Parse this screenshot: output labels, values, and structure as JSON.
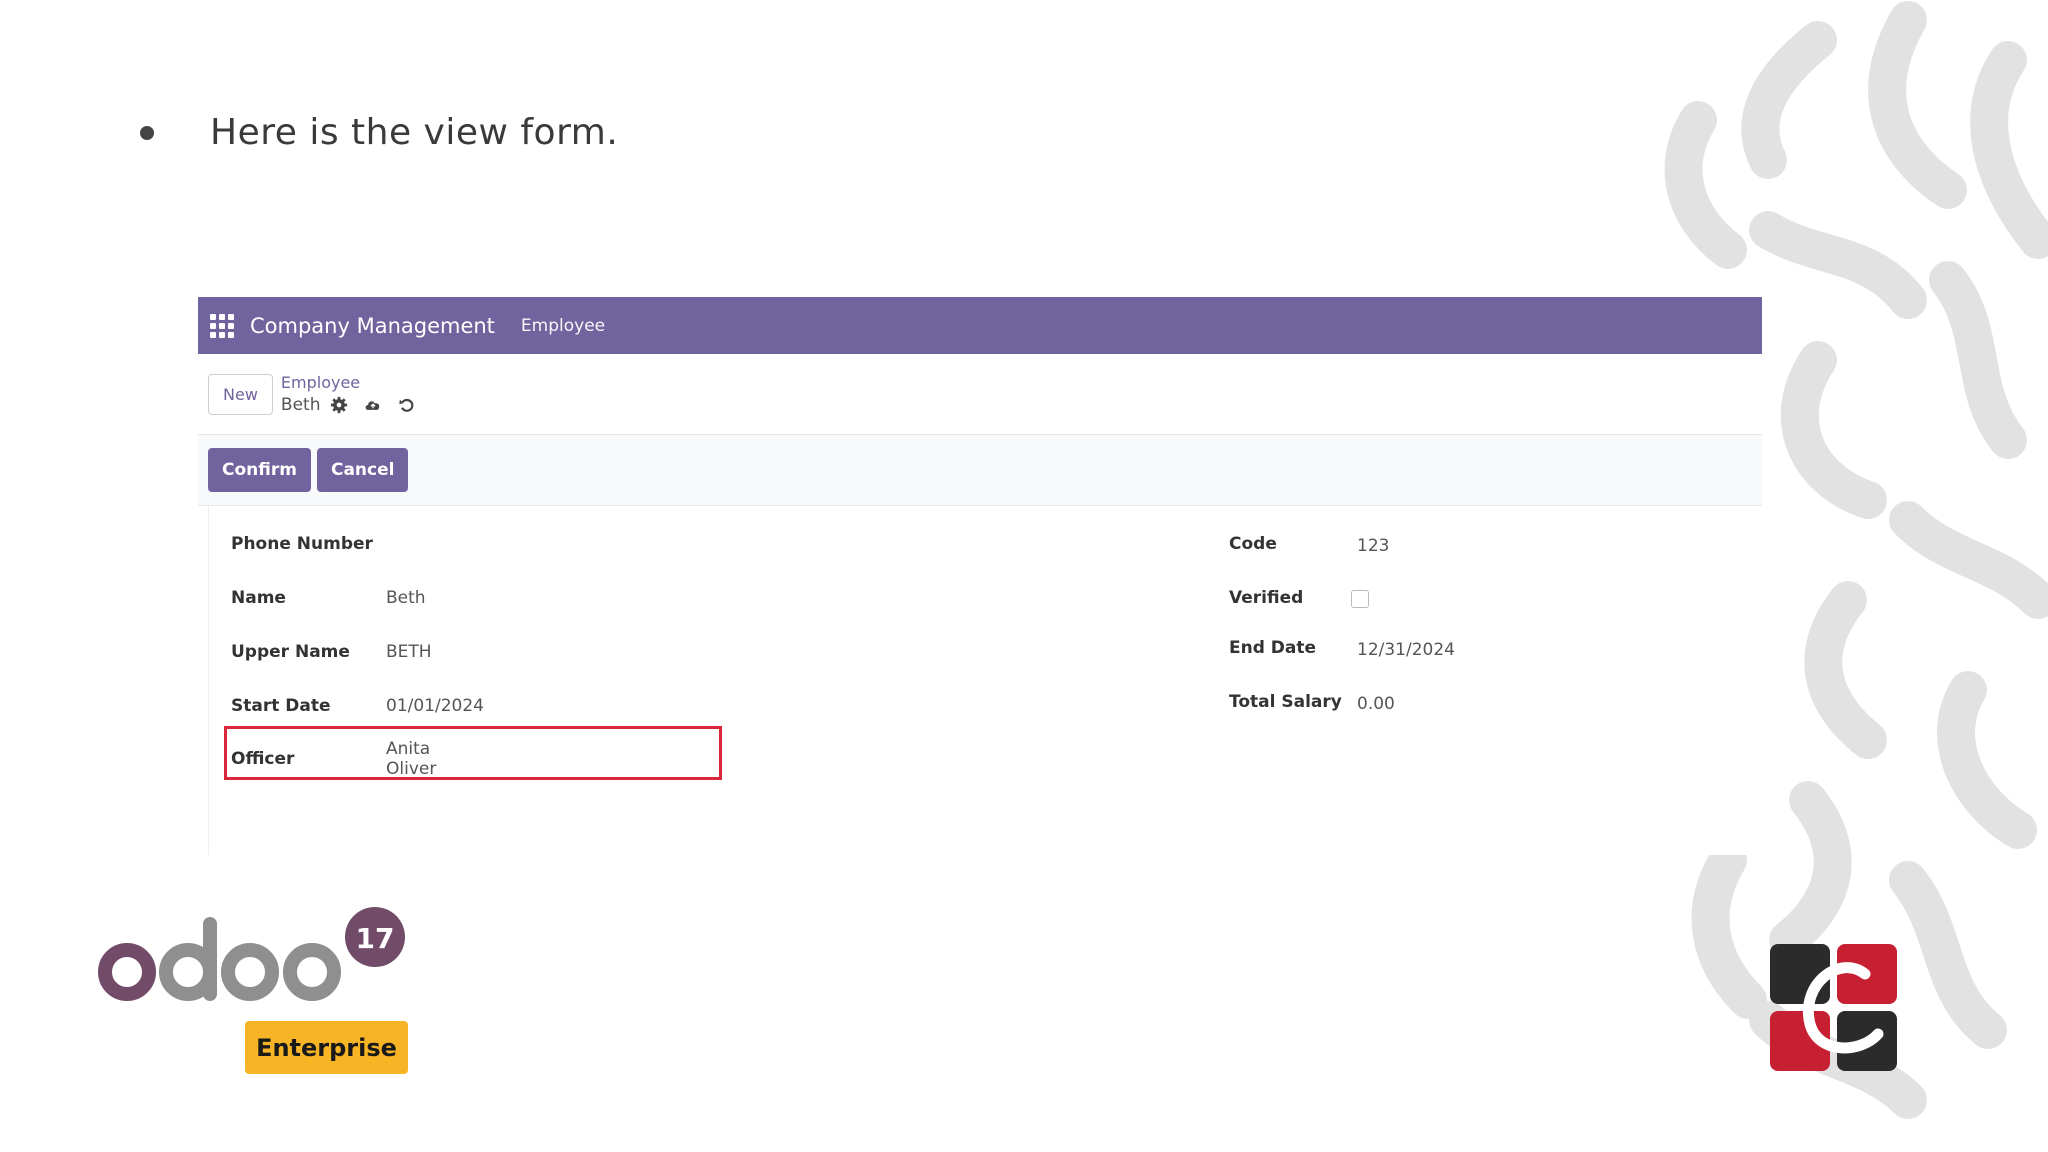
{
  "slide": {
    "bullet_text": "Here is the view form."
  },
  "navbar": {
    "app_name": "Company Management",
    "menu_item": "Employee"
  },
  "control_panel": {
    "new_button": "New",
    "breadcrumb_parent": "Employee",
    "breadcrumb_current": "Beth"
  },
  "statusbar": {
    "confirm_label": "Confirm",
    "cancel_label": "Cancel"
  },
  "form": {
    "left_fields": [
      {
        "label": "Phone Number",
        "value": ""
      },
      {
        "label": "Name",
        "value": "Beth"
      },
      {
        "label": "Upper Name",
        "value": "BETH"
      },
      {
        "label": "Start Date",
        "value": "01/01/2024"
      },
      {
        "label": "Officer",
        "value": "Anita Oliver"
      }
    ],
    "right_fields": [
      {
        "label": "Code",
        "value": "123"
      },
      {
        "label": "Verified",
        "value": ""
      },
      {
        "label": "End Date",
        "value": "12/31/2024"
      },
      {
        "label": "Total Salary",
        "value": "0.00"
      }
    ]
  },
  "logos": {
    "odoo_version": "17",
    "odoo_edition": "Enterprise"
  },
  "colors": {
    "brand": "#71639e",
    "highlight": "#d9263a",
    "enterprise": "#f7b526"
  },
  "icons": [
    "apps-grid-icon",
    "gear-icon",
    "cloud-save-icon",
    "undo-icon"
  ]
}
